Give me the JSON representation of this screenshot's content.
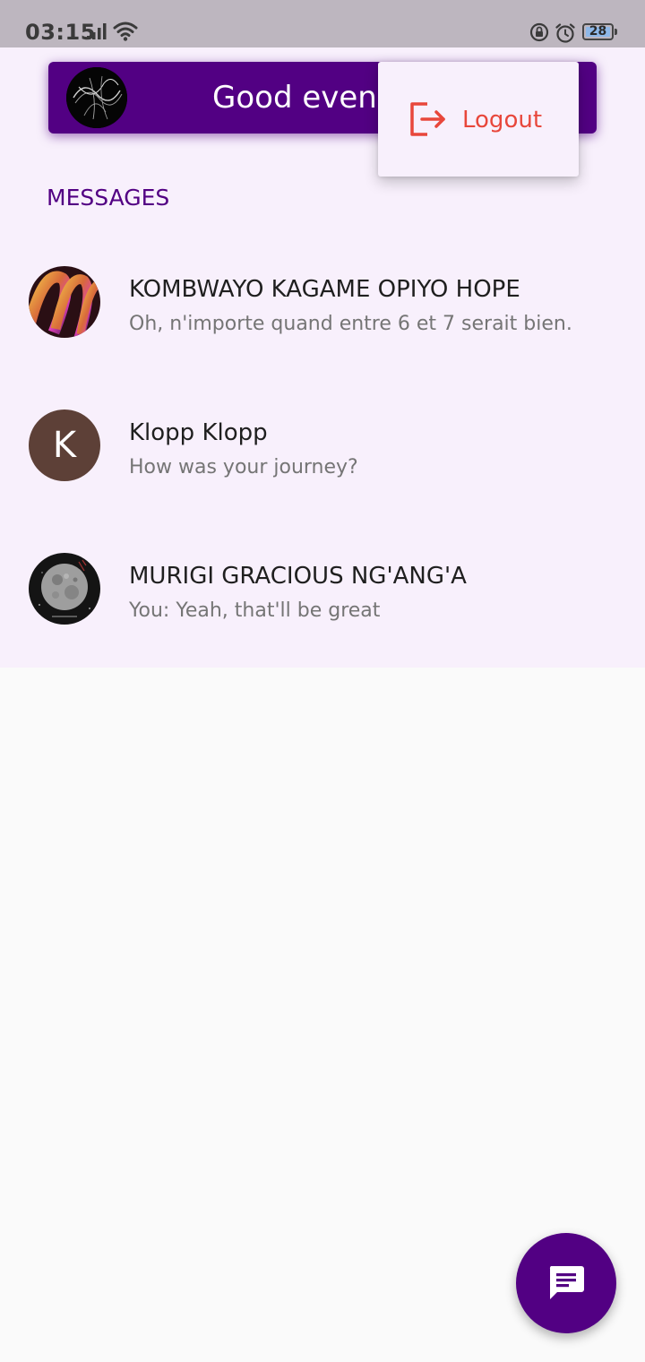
{
  "status_bar": {
    "time": "03:15",
    "battery_level": "28",
    "icons": [
      "signal-icon",
      "wifi-icon",
      "lock-rotation-icon",
      "alarm-icon",
      "battery-icon"
    ]
  },
  "header": {
    "greeting": "Good evening",
    "avatar_icon": "profile-avatar"
  },
  "menu": {
    "items": [
      {
        "label": "Logout",
        "icon": "logout-icon",
        "color": "#e8473b"
      }
    ]
  },
  "messages": {
    "section_title": "MESSAGES",
    "chats": [
      {
        "name": "KOMBWAYO KAGAME OPIYO HOPE",
        "preview": "Oh, n'importe quand entre 6 et 7 serait bien.",
        "avatar": "photo-avatar"
      },
      {
        "name": "Klopp Klopp",
        "preview": "How was your journey?",
        "avatar_initial": "K",
        "avatar_color": "#5d4037"
      },
      {
        "name": "MURIGI GRACIOUS NG'ANG'A",
        "preview": "You: Yeah, that'll be great",
        "avatar": "moon-photo-avatar"
      }
    ]
  },
  "fab": {
    "icon": "chat-icon"
  },
  "colors": {
    "primary": "#520083",
    "panel_background": "#f8f0fc",
    "page_background": "#fafafa",
    "danger": "#e8473b"
  }
}
